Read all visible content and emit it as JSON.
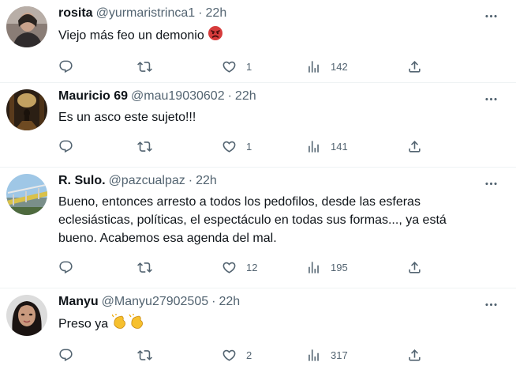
{
  "tweets": [
    {
      "name": "rosita",
      "handle": "@yurmaristrinca1",
      "time": "22h",
      "text": "Viejo más feo un demonio",
      "emoji": "angry-face",
      "likes": "1",
      "views": "142",
      "replies": "",
      "retweets": ""
    },
    {
      "name": "Mauricio 69",
      "handle": "@mau19030602",
      "time": "22h",
      "text": "Es un asco este sujeto!!!",
      "likes": "1",
      "views": "141",
      "replies": "",
      "retweets": ""
    },
    {
      "name": "R. Sulo.",
      "handle": "@pazcualpaz",
      "time": "22h",
      "text_lines": [
        "Bueno, entonces arresto a todos los pedofilos, desde las esferas",
        "eclesiásticas, políticas, el espectáculo en todas sus formas..., ya está",
        "bueno. Acabemos esa agenda del mal."
      ],
      "likes": "12",
      "views": "195",
      "replies": "",
      "retweets": ""
    },
    {
      "name": "Manyu",
      "handle": "@Manyu27902505",
      "time": "22h",
      "text": "Preso ya",
      "emoji": "clapping-hands x2",
      "likes": "2",
      "views": "317",
      "replies": "",
      "retweets": ""
    }
  ],
  "separator": "·",
  "icons": {
    "reply": "reply-icon",
    "retweet": "retweet-icon",
    "like": "heart-icon",
    "views": "views-chart-icon",
    "share": "share-icon",
    "more": "more-dots-icon"
  },
  "colors": {
    "text": "#0f1419",
    "secondary": "#536471",
    "border": "#eff3f4",
    "emoji_angry": "#d63b3b",
    "emoji_clap": "#f6c02e"
  }
}
